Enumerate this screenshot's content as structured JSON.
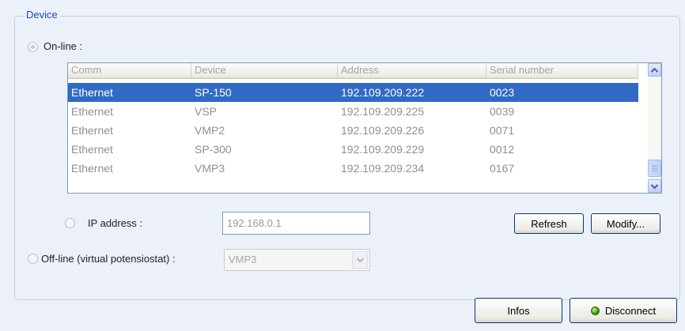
{
  "group": {
    "title": "Device"
  },
  "online": {
    "label": "On-line :",
    "selected": true
  },
  "device_list": {
    "columns": [
      "Comm",
      "Device",
      "Address",
      "Serial number"
    ],
    "rows": [
      {
        "comm": "Ethernet",
        "device": "SP-150",
        "address": "192.109.209.222",
        "serial": "0023"
      },
      {
        "comm": "Ethernet",
        "device": "VSP",
        "address": "192.109.209.225",
        "serial": "0039"
      },
      {
        "comm": "Ethernet",
        "device": "VMP2",
        "address": "192.109.209.226",
        "serial": "0071"
      },
      {
        "comm": "Ethernet",
        "device": "SP-300",
        "address": "192.109.209.229",
        "serial": "0012"
      },
      {
        "comm": "Ethernet",
        "device": "VMP3",
        "address": "192.109.209.234",
        "serial": "0167"
      }
    ],
    "selected_row": "SP-150"
  },
  "ip": {
    "label": "IP address :",
    "value": "192.168.0.1"
  },
  "offline": {
    "label": "Off-line (virtual potensiostat) :",
    "selected_value": "VMP3"
  },
  "buttons": {
    "refresh": "Refresh",
    "modify": "Modify...",
    "infos": "Infos",
    "disconnect": "Disconnect"
  },
  "colors": {
    "selection": "#316ac5",
    "group_title": "#1f49b8",
    "led": "#2fa100"
  },
  "icons": {
    "scroll_up": "chevron-up-icon",
    "scroll_down": "chevron-down-icon",
    "combo": "chevron-down-icon",
    "status": "green-led-icon"
  }
}
